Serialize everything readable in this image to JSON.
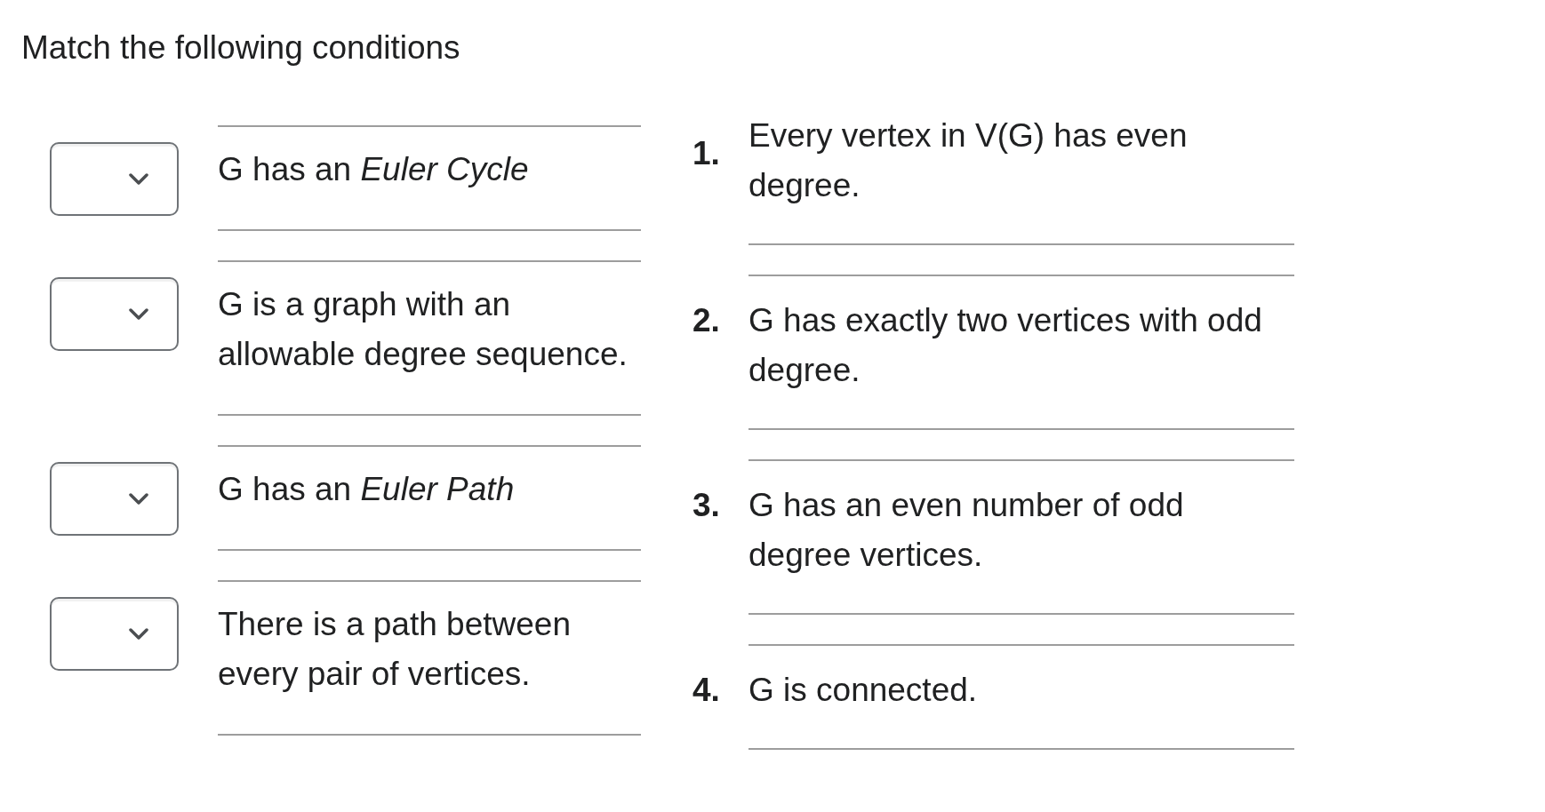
{
  "title": "Match the following conditions",
  "premises": [
    {
      "text": "G has an *Euler Cycle*"
    },
    {
      "text": "G is a graph with an allowable degree sequence."
    },
    {
      "text": "G has an *Euler Path*"
    },
    {
      "text": "There is a path between every pair of vertices."
    }
  ],
  "choices": [
    {
      "number": "1.",
      "text": "Every vertex in V(G) has even degree."
    },
    {
      "number": "2.",
      "text": "G has exactly two vertices with odd degree."
    },
    {
      "number": "3.",
      "text": "G has an even number of odd degree vertices."
    },
    {
      "number": "4.",
      "text": "G is connected."
    }
  ]
}
